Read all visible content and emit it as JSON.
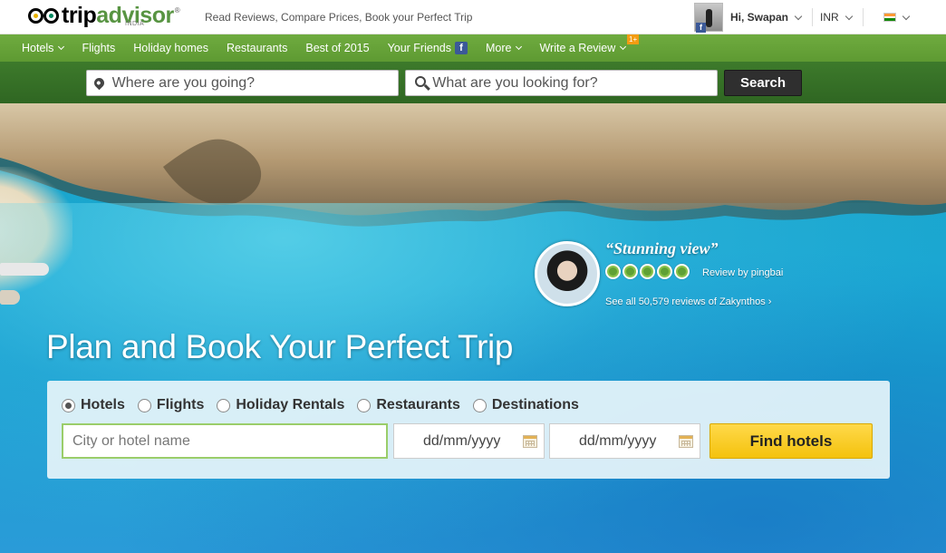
{
  "header": {
    "logo_main": "trip",
    "logo_accent": "advisor",
    "logo_reg": "®",
    "logo_sub": "INDIA",
    "tagline": "Read Reviews, Compare Prices, Book your Perfect Trip",
    "user_greeting": "Hi, Swapan",
    "currency": "INR",
    "fb_letter": "f"
  },
  "nav": {
    "items": [
      {
        "label": "Hotels",
        "dropdown": true
      },
      {
        "label": "Flights",
        "dropdown": false
      },
      {
        "label": "Holiday homes",
        "dropdown": false
      },
      {
        "label": "Restaurants",
        "dropdown": false
      },
      {
        "label": "Best of 2015",
        "dropdown": false
      },
      {
        "label": "Your Friends",
        "dropdown": false
      },
      {
        "label": "More",
        "dropdown": true
      },
      {
        "label": "Write a Review",
        "dropdown": true
      }
    ],
    "badge": "1+",
    "fb_letter": "f"
  },
  "search": {
    "where_placeholder": "Where are you going?",
    "what_placeholder": "What are you looking for?",
    "button_label": "Search"
  },
  "review": {
    "quote": "“Stunning view”",
    "rating": 5,
    "review_by": "Review by pingbai",
    "see_all": "See all 50,579 reviews of Zakynthos",
    "see_all_arrow": "›"
  },
  "hero": {
    "headline": "Plan and Book Your Perfect Trip"
  },
  "booking": {
    "options": [
      {
        "label": "Hotels",
        "checked": true
      },
      {
        "label": "Flights",
        "checked": false
      },
      {
        "label": "Holiday Rentals",
        "checked": false
      },
      {
        "label": "Restaurants",
        "checked": false
      },
      {
        "label": "Destinations",
        "checked": false
      }
    ],
    "city_placeholder": "City or hotel name",
    "checkin_placeholder": "dd/mm/yyyy",
    "checkout_placeholder": "dd/mm/yyyy",
    "find_label": "Find hotels"
  },
  "colors": {
    "nav_green": "#5e9a32",
    "search_green": "#3d7a2b",
    "find_yellow": "#f4c20d",
    "bubble_green": "#5fa135"
  }
}
